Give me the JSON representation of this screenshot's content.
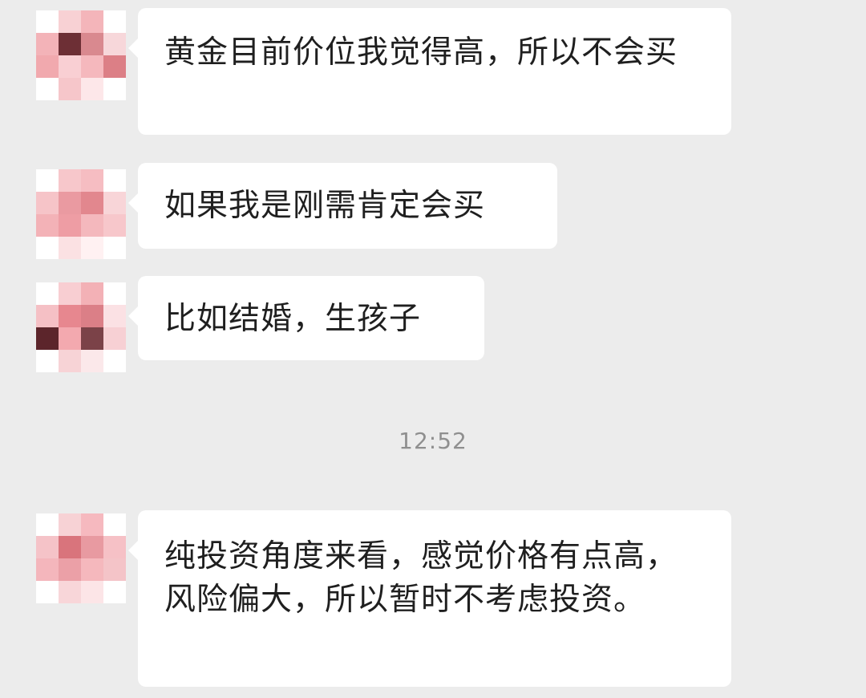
{
  "messages": [
    {
      "text": "黄金目前价位我觉得高，所以不会买"
    },
    {
      "text": "如果我是刚需肯定会买"
    },
    {
      "text": "比如结婚，生孩子"
    },
    {
      "text": "纯投资角度来看，感觉价格有点高，风险偏大，所以暂时不考虑投资。"
    }
  ],
  "timestamp": "12:52",
  "avatar_colors": {
    "pink_light": "#f7c7cb",
    "pink_mid": "#ee9da4",
    "pink_deep": "#dc7f86",
    "dark": "#6d2f35",
    "white": "#ffffff"
  }
}
